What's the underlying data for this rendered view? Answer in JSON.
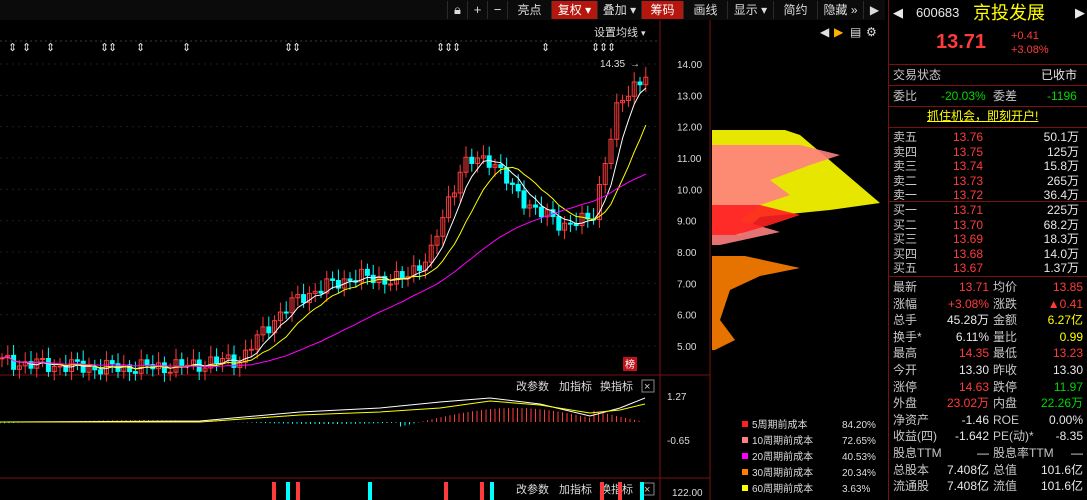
{
  "toolbar": {
    "icons": [
      "lock-icon",
      "plus-icon",
      "minus-icon"
    ],
    "buttons": [
      "亮点",
      "复权",
      "叠加",
      "筹码",
      "画线",
      "显示",
      "简约",
      "隐藏"
    ],
    "nav": [
      "◀",
      "▶"
    ],
    "active_buttons": [
      "复权",
      "筹码"
    ]
  },
  "chart": {
    "ma_setting_label": "设置均线",
    "high_marker": "14.35",
    "price_ticks": [
      "14.00",
      "13.00",
      "12.00",
      "11.00",
      "10.00",
      "9.00",
      "8.00",
      "7.00",
      "6.00",
      "5.00"
    ],
    "badge": "榜",
    "macd_params_label": "改参数",
    "macd_add_label": "加指标",
    "macd_switch_label": "换指标",
    "macd_ticks": [
      "1.27",
      "-0.65"
    ],
    "vol_params_label": "改参数",
    "vol_add_label": "加指标",
    "vol_switch_label": "换指标",
    "vol_ticks": [
      "122.00"
    ]
  },
  "chart_data": {
    "type": "candlestick",
    "y_range": [
      4.0,
      14.5
    ],
    "ma_lines": [
      "white",
      "yellow",
      "magenta"
    ],
    "chip_legend": [
      {
        "name": "5周期前成本",
        "pct": "84.20%",
        "color": "#ff2020"
      },
      {
        "name": "10周期前成本",
        "pct": "72.65%",
        "color": "#ff8080"
      },
      {
        "name": "20周期前成本",
        "pct": "40.53%",
        "color": "#ff00ff"
      },
      {
        "name": "30周期前成本",
        "pct": "20.34%",
        "color": "#ff8000"
      },
      {
        "name": "60周期前成本",
        "pct": "3.63%",
        "color": "#ffff00"
      }
    ]
  },
  "quote": {
    "code": "600683",
    "name": "京投发展",
    "price": "13.71",
    "change": "+0.41",
    "change_pct": "+3.08%",
    "status_label": "交易状态",
    "status_value": "已收市",
    "weibi_label": "委比",
    "weibi_value": "-20.03%",
    "weicha_label": "委差",
    "weicha_value": "-1196",
    "promo": "抓住机会，即刻开户!",
    "asks": [
      {
        "label": "卖五",
        "price": "13.76",
        "vol": "50.1万"
      },
      {
        "label": "卖四",
        "price": "13.75",
        "vol": "125万"
      },
      {
        "label": "卖三",
        "price": "13.74",
        "vol": "15.8万"
      },
      {
        "label": "卖二",
        "price": "13.73",
        "vol": "265万"
      },
      {
        "label": "卖一",
        "price": "13.72",
        "vol": "36.4万"
      }
    ],
    "bids": [
      {
        "label": "买一",
        "price": "13.71",
        "vol": "225万"
      },
      {
        "label": "买二",
        "price": "13.70",
        "vol": "68.2万"
      },
      {
        "label": "买三",
        "price": "13.69",
        "vol": "18.3万"
      },
      {
        "label": "买四",
        "price": "13.68",
        "vol": "14.0万"
      },
      {
        "label": "买五",
        "price": "13.67",
        "vol": "1.37万"
      }
    ],
    "stats": [
      {
        "l1": "最新",
        "v1": "13.71",
        "c1": "red",
        "l2": "均价",
        "v2": "13.85",
        "c2": "red"
      },
      {
        "l1": "涨幅",
        "v1": "+3.08%",
        "c1": "red",
        "l2": "涨跌",
        "v2": "▲0.41",
        "c2": "red"
      },
      {
        "l1": "总手",
        "v1": "45.28万",
        "c1": "wht",
        "l2": "金额",
        "v2": "6.27亿",
        "c2": "yel"
      },
      {
        "l1": "换手*",
        "v1": "6.11%",
        "c1": "wht",
        "l2": "量比",
        "v2": "0.99",
        "c2": "yel"
      },
      {
        "l1": "最高",
        "v1": "14.35",
        "c1": "red",
        "l2": "最低",
        "v2": "13.23",
        "c2": "red"
      },
      {
        "l1": "今开",
        "v1": "13.30",
        "c1": "wht",
        "l2": "昨收",
        "v2": "13.30",
        "c2": "wht"
      },
      {
        "l1": "涨停",
        "v1": "14.63",
        "c1": "red",
        "l2": "跌停",
        "v2": "11.97",
        "c2": "grn"
      },
      {
        "l1": "外盘",
        "v1": "23.02万",
        "c1": "red",
        "l2": "内盘",
        "v2": "22.26万",
        "c2": "grn"
      },
      {
        "l1": "净资产",
        "v1": "-1.46",
        "c1": "wht",
        "l2": "ROE",
        "v2": "0.00%",
        "c2": "wht"
      },
      {
        "l1": "收益(四)",
        "v1": "-1.642",
        "c1": "wht",
        "l2": "PE(动)*",
        "v2": "-8.35",
        "c2": "wht"
      },
      {
        "l1": "股息TTM",
        "v1": "—",
        "c1": "wht",
        "l2": "股息率TTM",
        "v2": "—",
        "c2": "wht"
      },
      {
        "l1": "总股本",
        "v1": "7.408亿",
        "c1": "wht",
        "l2": "总值",
        "v2": "101.6亿",
        "c2": "wht"
      },
      {
        "l1": "流通股",
        "v1": "7.408亿",
        "c1": "wht",
        "l2": "流值",
        "v2": "101.6亿",
        "c2": "wht"
      }
    ]
  }
}
